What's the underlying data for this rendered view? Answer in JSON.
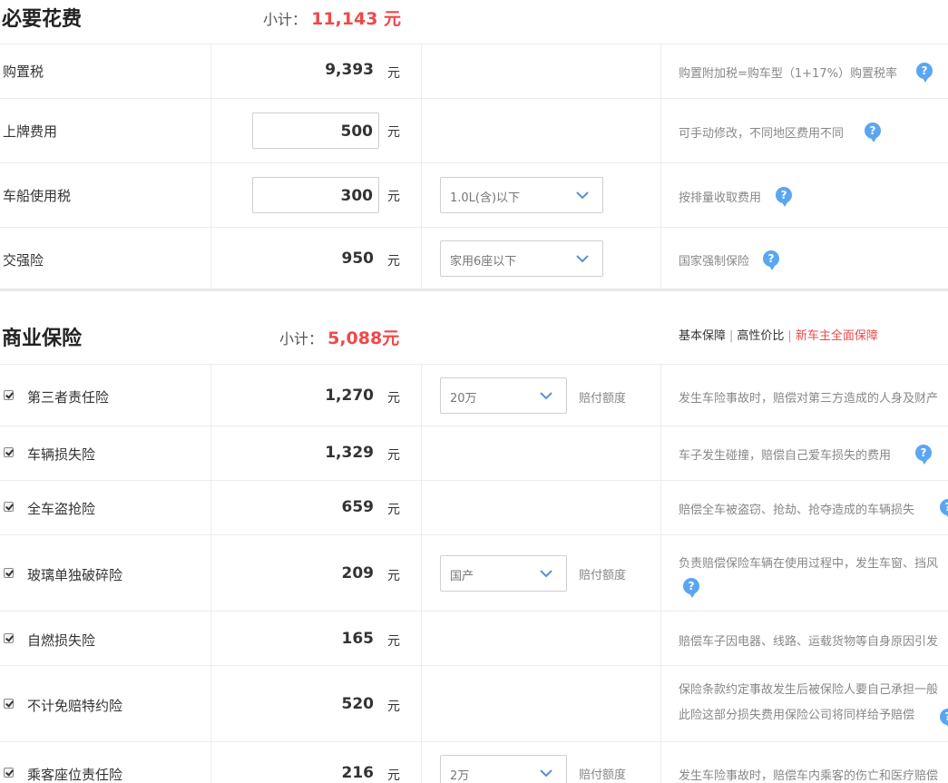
{
  "required": {
    "title": "必要花费",
    "subtotal_label": "小计：",
    "subtotal_value": "11,143 元",
    "rows": [
      {
        "label": "购置税",
        "value": "9,393",
        "unit": "元",
        "note": "购置附加税=购车型（1+17%）购置税率"
      },
      {
        "label": "上牌费用",
        "value": "500",
        "unit": "元",
        "note": "可手动修改，不同地区费用不同"
      },
      {
        "label": "车船使用税",
        "value": "300",
        "unit": "元",
        "select": "1.0L(含)以下",
        "note": "按排量收取费用"
      },
      {
        "label": "交强险",
        "value": "950",
        "unit": "元",
        "select": "家用6座以下",
        "note": "国家强制保险"
      }
    ]
  },
  "commercial": {
    "title": "商业保险",
    "subtotal_label": "小计：",
    "subtotal_value": "5,088元",
    "tabs": [
      "基本保障",
      "高性价比",
      "新车主全面保障"
    ],
    "coverage_label": "赔付额度",
    "rows": [
      {
        "label": "第三者责任险",
        "value": "1,270",
        "unit": "元",
        "select": "20万",
        "note": "发生车险事故时，赔偿对第三方造成的人身及财产",
        "checked": true
      },
      {
        "label": "车辆损失险",
        "value": "1,329",
        "unit": "元",
        "note": "车子发生碰撞，赔偿自己爱车损失的费用",
        "checked": true
      },
      {
        "label": "全车盗抢险",
        "value": "659",
        "unit": "元",
        "note": "赔偿全车被盗窃、抢劫、抢夺造成的车辆损失",
        "checked": true
      },
      {
        "label": "玻璃单独破碎险",
        "value": "209",
        "unit": "元",
        "select": "国产",
        "note": "负责赔偿保险车辆在使用过程中，发生车窗、挡风",
        "checked": true
      },
      {
        "label": "自燃损失险",
        "value": "165",
        "unit": "元",
        "note": "赔偿车子因电器、线路、运载货物等自身原因引发",
        "checked": true
      },
      {
        "label": "不计免赔特约险",
        "value": "520",
        "unit": "元",
        "note_line1": "保险条款约定事故发生后被保险人要自己承担一般",
        "note_line2": "此险这部分损失费用保险公司将同样给予赔偿",
        "checked": true
      },
      {
        "label": "乘客座位责任险",
        "value": "216",
        "unit": "元",
        "select": "2万",
        "note": "发生车险事故时，赔偿车内乘客的伤亡和医疗赔偿",
        "checked": true
      }
    ]
  },
  "icons": {
    "help": "question-icon",
    "dropdown": "chevron-down-icon",
    "checkbox": "checkbox-icon"
  },
  "colors": {
    "accent_red": "#f04848",
    "help_blue": "#5aa6f2"
  }
}
